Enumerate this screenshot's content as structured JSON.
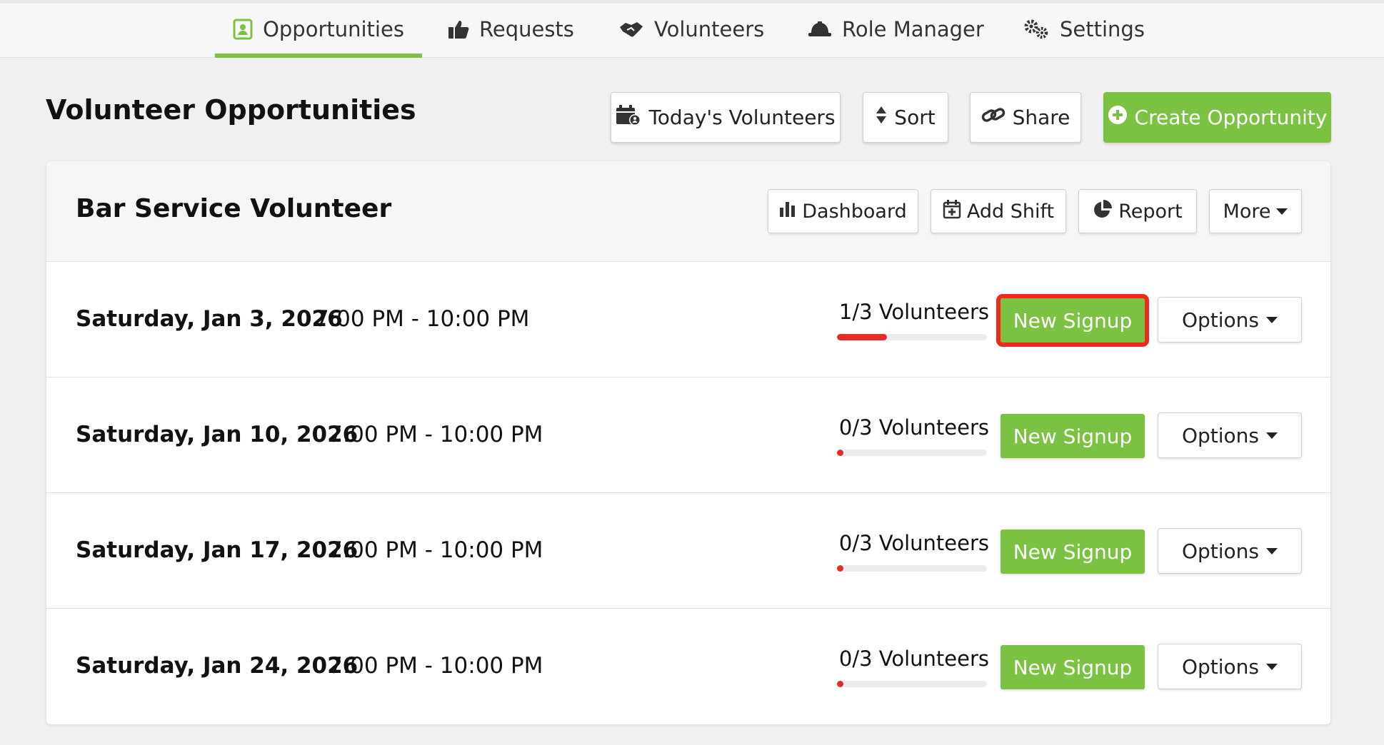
{
  "nav": {
    "tabs": [
      {
        "label": "Opportunities",
        "icon": "contact-card-icon",
        "active": true
      },
      {
        "label": "Requests",
        "icon": "thumbs-up-icon",
        "active": false
      },
      {
        "label": "Volunteers",
        "icon": "handshake-icon",
        "active": false
      },
      {
        "label": "Role Manager",
        "icon": "hard-hat-icon",
        "active": false
      },
      {
        "label": "Settings",
        "icon": "gears-icon",
        "active": false
      }
    ]
  },
  "header": {
    "title": "Volunteer Opportunities",
    "todays_label": "Today's Volunteers",
    "sort_label": "Sort",
    "share_label": "Share",
    "create_label": "Create Opportunity"
  },
  "opportunity": {
    "title": "Bar Service Volunteer",
    "dashboard_label": "Dashboard",
    "add_shift_label": "Add Shift",
    "report_label": "Report",
    "more_label": "More",
    "shifts": [
      {
        "date": "Saturday, Jan 3, 2026",
        "time": "7:00 PM - 10:00 PM",
        "volunteers": "1/3 Volunteers",
        "filled_fraction": 0.333,
        "signup_label": "New Signup",
        "options_label": "Options",
        "highlighted": true
      },
      {
        "date": "Saturday, Jan 10, 2026",
        "time": "7:00 PM - 10:00 PM",
        "volunteers": "0/3 Volunteers",
        "filled_fraction": 0,
        "signup_label": "New Signup",
        "options_label": "Options",
        "highlighted": false
      },
      {
        "date": "Saturday, Jan 17, 2026",
        "time": "7:00 PM - 10:00 PM",
        "volunteers": "0/3 Volunteers",
        "filled_fraction": 0,
        "signup_label": "New Signup",
        "options_label": "Options",
        "highlighted": false
      },
      {
        "date": "Saturday, Jan 24, 2026",
        "time": "7:00 PM - 10:00 PM",
        "volunteers": "0/3 Volunteers",
        "filled_fraction": 0,
        "signup_label": "New Signup",
        "options_label": "Options",
        "highlighted": false
      }
    ]
  },
  "colors": {
    "accent_green": "#7cc242",
    "progress_red": "#e32b2b",
    "highlight_red": "#ee2a1b"
  }
}
